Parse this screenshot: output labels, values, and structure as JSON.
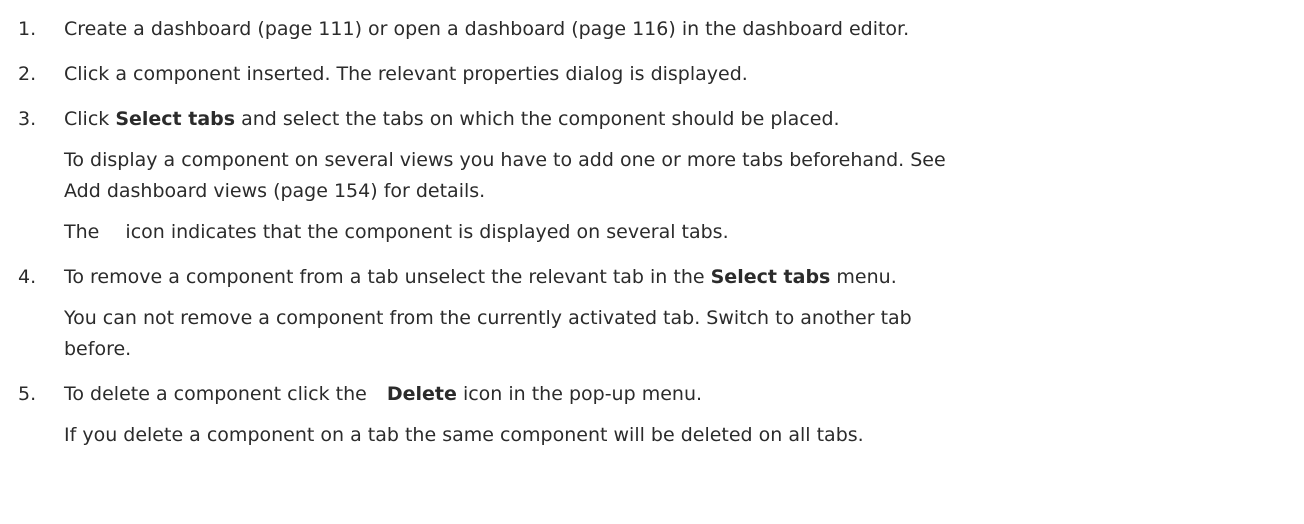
{
  "steps": [
    {
      "number": "1.",
      "text": "Create a dashboard (page 111) or open a dashboard (page 116) in the dashboard editor."
    },
    {
      "number": "2.",
      "text": "Click a component inserted. The relevant properties dialog is displayed."
    },
    {
      "number": "3.",
      "text_before": "Click ",
      "bold": "Select tabs",
      "text_after": " and select the tabs on which the component should be placed.",
      "note1_line1": "To display a component on several views you have to add one or more tabs beforehand. See",
      "note1_line2": "Add dashboard views (page 154) for details.",
      "note2_before": "The ",
      "note2_after": " icon indicates that the component is displayed on several tabs."
    },
    {
      "number": "4.",
      "text_before": "To remove a component from a tab unselect the relevant tab in the ",
      "bold": "Select tabs",
      "text_after": " menu.",
      "note_line1": "You can not remove a component from the currently activated tab. Switch to another tab",
      "note_line2": "before."
    },
    {
      "number": "5.",
      "text_before": "To delete a component click the ",
      "bold": "Delete",
      "text_after": " icon in the pop-up menu.",
      "note": "If you delete a component on a tab the same component will be deleted on all tabs."
    }
  ]
}
